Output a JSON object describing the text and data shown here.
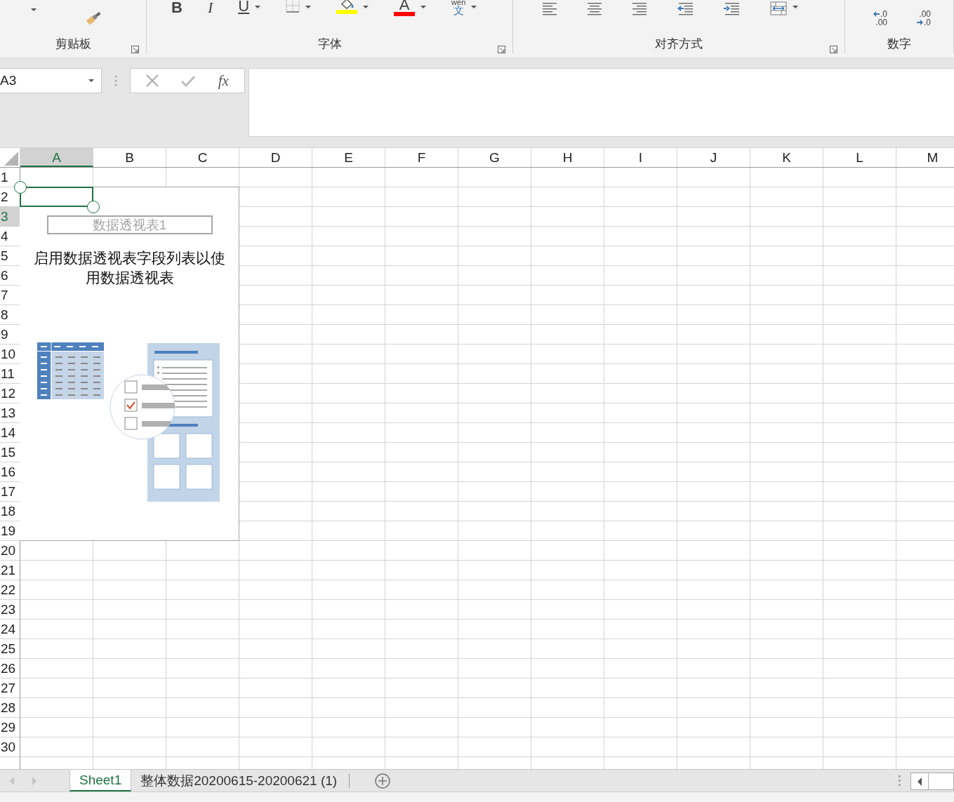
{
  "ribbon": {
    "groups": [
      {
        "label": "剪贴板",
        "launcher": true,
        "buttons": [
          {
            "kind": "dropdown-caret"
          },
          {
            "kind": "format-painter"
          }
        ]
      },
      {
        "label": "字体",
        "launcher": true,
        "buttons": [
          {
            "kind": "bold",
            "glyph": "B"
          },
          {
            "kind": "italic",
            "glyph": "I"
          },
          {
            "kind": "underline",
            "glyph": "U",
            "dropdown": true
          },
          {
            "kind": "borders",
            "dropdown": true
          },
          {
            "kind": "fill-color",
            "dropdown": true,
            "color": "#ffff00"
          },
          {
            "kind": "font-color",
            "glyph": "A",
            "dropdown": true,
            "color": "#ff0000"
          },
          {
            "kind": "phonetic",
            "glyph": "wen",
            "subglyph": "文",
            "dropdown": true
          }
        ]
      },
      {
        "label": "对齐方式",
        "launcher": true,
        "buttons": [
          {
            "kind": "align-left"
          },
          {
            "kind": "align-center"
          },
          {
            "kind": "align-right"
          },
          {
            "kind": "decrease-indent"
          },
          {
            "kind": "increase-indent"
          },
          {
            "kind": "merge",
            "dropdown": true
          }
        ]
      },
      {
        "label": "数字",
        "launcher": false,
        "buttons": [
          {
            "kind": "increase-decimal",
            "top": ".0",
            "bottom": ".00"
          },
          {
            "kind": "decrease-decimal",
            "top": ".00",
            "bottom": ".0"
          }
        ]
      }
    ]
  },
  "formula_bar": {
    "name_box": "A3",
    "fx": "fx"
  },
  "columns": [
    {
      "label": "A",
      "selected": true
    },
    {
      "label": "B",
      "selected": false
    },
    {
      "label": "C",
      "selected": false
    },
    {
      "label": "D",
      "selected": false
    },
    {
      "label": "E",
      "selected": false
    },
    {
      "label": "F",
      "selected": false
    },
    {
      "label": "G",
      "selected": false
    },
    {
      "label": "H",
      "selected": false
    },
    {
      "label": "I",
      "selected": false
    },
    {
      "label": "J",
      "selected": false
    },
    {
      "label": "K",
      "selected": false
    },
    {
      "label": "L",
      "selected": false
    },
    {
      "label": "M",
      "selected": false
    }
  ],
  "rows": [
    {
      "label": "1",
      "selected": false
    },
    {
      "label": "2",
      "selected": false
    },
    {
      "label": "3",
      "selected": true
    },
    {
      "label": "4",
      "selected": false
    },
    {
      "label": "5",
      "selected": false
    },
    {
      "label": "6",
      "selected": false
    },
    {
      "label": "7",
      "selected": false
    },
    {
      "label": "8",
      "selected": false
    },
    {
      "label": "9",
      "selected": false
    },
    {
      "label": "10",
      "selected": false
    },
    {
      "label": "11",
      "selected": false
    },
    {
      "label": "12",
      "selected": false
    },
    {
      "label": "13",
      "selected": false
    },
    {
      "label": "14",
      "selected": false
    },
    {
      "label": "15",
      "selected": false
    },
    {
      "label": "16",
      "selected": false
    },
    {
      "label": "17",
      "selected": false
    },
    {
      "label": "18",
      "selected": false
    },
    {
      "label": "19",
      "selected": false
    },
    {
      "label": "20",
      "selected": false
    },
    {
      "label": "21",
      "selected": false
    },
    {
      "label": "22",
      "selected": false
    },
    {
      "label": "23",
      "selected": false
    },
    {
      "label": "24",
      "selected": false
    },
    {
      "label": "25",
      "selected": false
    },
    {
      "label": "26",
      "selected": false
    },
    {
      "label": "27",
      "selected": false
    },
    {
      "label": "28",
      "selected": false
    },
    {
      "label": "29",
      "selected": false
    },
    {
      "label": "30",
      "selected": false
    }
  ],
  "pivot": {
    "name": "数据透视表1",
    "message": "启用数据透视表字段列表以使用数据透视表"
  },
  "sheet_tabs": [
    {
      "label": "Sheet1",
      "selected": true
    },
    {
      "label": "整体数据20200615-20200621 (1)",
      "selected": false
    }
  ]
}
